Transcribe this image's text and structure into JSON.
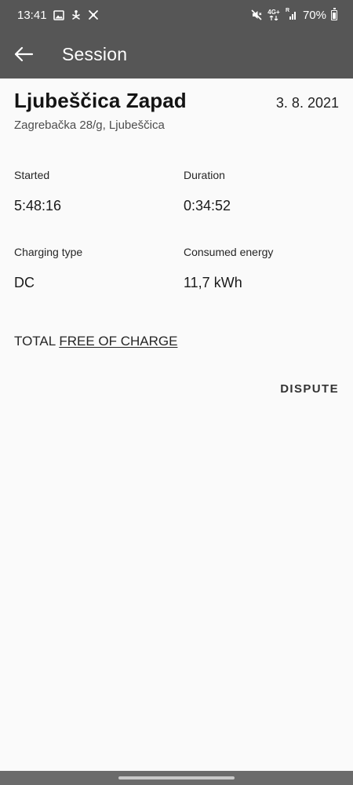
{
  "status_bar": {
    "time": "13:41",
    "battery": "70%",
    "left_icons": [
      "image-icon",
      "yoga-icon",
      "app-icon"
    ],
    "right_icons": [
      "mute-icon",
      "network-4g-icon",
      "signal-icon",
      "battery-icon"
    ],
    "network_label_top": "4G+",
    "network_label_side": "R"
  },
  "app_bar": {
    "title": "Session",
    "back_icon": "arrow-left-icon"
  },
  "session": {
    "station_name": "Ljubeščica Zapad",
    "date": "3. 8. 2021",
    "address": "Zagrebačka 28/g, Ljubeščica",
    "started_label": "Started",
    "started_value": "5:48:16",
    "duration_label": "Duration",
    "duration_value": "0:34:52",
    "charging_type_label": "Charging type",
    "charging_type_value": "DC",
    "energy_label": "Consumed energy",
    "energy_value": "11,7 kWh",
    "total_label": "TOTAL",
    "total_value": "FREE OF CHARGE"
  },
  "actions": {
    "dispute_label": "DISPUTE"
  },
  "colors": {
    "app_bar": "#565656",
    "background": "#fafafa",
    "nav_bar": "#6b6b6b"
  }
}
